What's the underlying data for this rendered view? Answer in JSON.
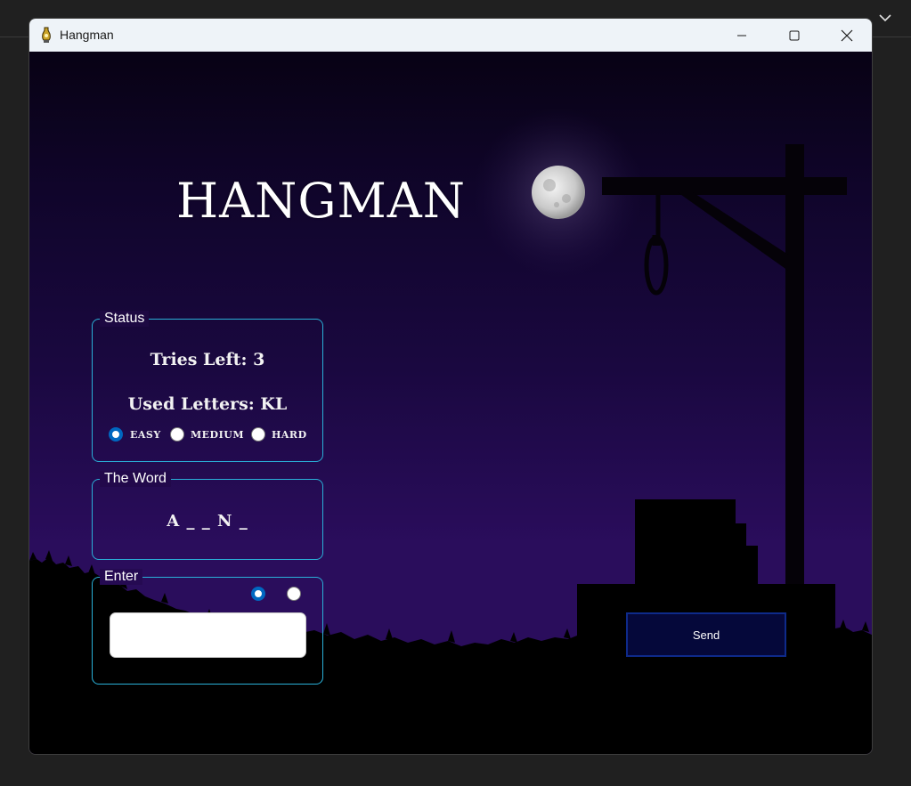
{
  "window": {
    "title": "Hangman"
  },
  "game": {
    "title": "HANGMAN"
  },
  "status": {
    "legend": "Status",
    "tries_left": "Tries Left: 3",
    "used_letters": "Used Letters: KL",
    "difficulty_options": [
      {
        "label": "EASY",
        "selected": true
      },
      {
        "label": "MEDIUM",
        "selected": false
      },
      {
        "label": "HARD",
        "selected": false
      }
    ]
  },
  "word": {
    "legend": "The Word",
    "display": "A _ _ N _"
  },
  "enter": {
    "legend": "Enter",
    "input_value": "",
    "mode_options": [
      {
        "selected": true
      },
      {
        "selected": false
      }
    ]
  },
  "send": {
    "label": "Send"
  },
  "icons": {
    "app": "lightbulb-icon",
    "minimize": "minimize-icon",
    "maximize": "maximize-icon",
    "close": "close-icon",
    "desktop": "chevron-down-icon"
  },
  "colors": {
    "accent": "#0067c0",
    "groupbox_border": "#2ab0d8",
    "send_bg": "#05083a",
    "sky_top": "#080214",
    "sky_bottom": "#2a0d5c"
  }
}
